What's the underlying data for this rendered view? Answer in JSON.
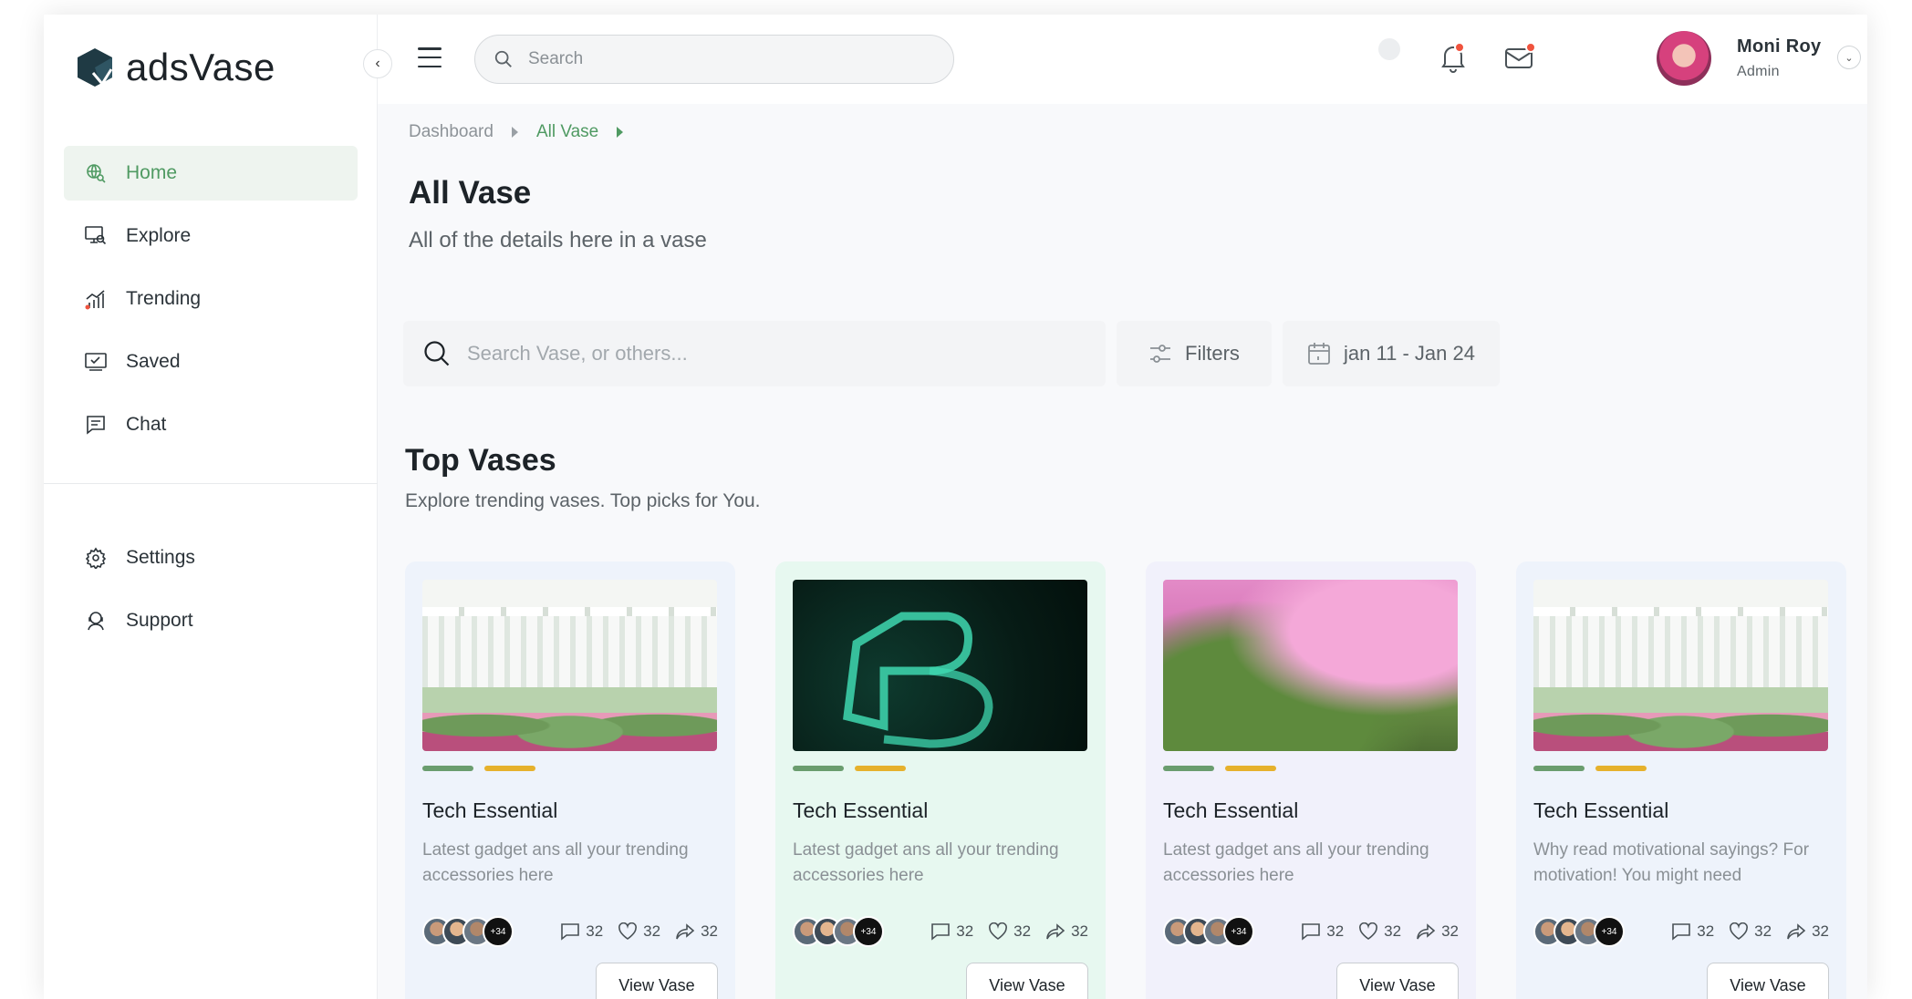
{
  "app": {
    "name": "adsVase"
  },
  "sidebar": {
    "items": [
      {
        "label": "Home",
        "icon": "globe-search-icon",
        "active": true
      },
      {
        "label": "Explore",
        "icon": "monitor-search-icon"
      },
      {
        "label": "Trending",
        "icon": "chart-bars-icon"
      },
      {
        "label": "Saved",
        "icon": "saved-monitor-icon"
      },
      {
        "label": "Chat",
        "icon": "chat-icon"
      }
    ],
    "secondary": [
      {
        "label": "Settings",
        "icon": "gear-icon"
      },
      {
        "label": "Support",
        "icon": "headset-icon"
      }
    ]
  },
  "topbar": {
    "search_placeholder": "Search",
    "user": {
      "name": "Moni Roy",
      "role": "Admin"
    }
  },
  "breadcrumb": {
    "root": "Dashboard",
    "current": "All Vase"
  },
  "page": {
    "title": "All Vase",
    "subtitle": "All of the details here in  a vase"
  },
  "filters": {
    "search_placeholder": "Search Vase, or others...",
    "filters_label": "Filters",
    "date_range": "jan 11 - Jan 24"
  },
  "section": {
    "title": "Top Vases",
    "subtitle": "Explore trending vases.  Top picks for You."
  },
  "cards": [
    {
      "title": "Tech Essential",
      "desc": "Latest gadget ans all your trending accessories here",
      "more": "+34",
      "comments": "32",
      "likes": "32",
      "shares": "32",
      "button": "View Vase",
      "image": "greenhouse"
    },
    {
      "title": "Tech Essential",
      "desc": "Latest gadget ans all your trending accessories here",
      "more": "+34",
      "comments": "32",
      "likes": "32",
      "shares": "32",
      "button": "View Vase",
      "image": "neon-sign"
    },
    {
      "title": "Tech Essential",
      "desc": "Latest gadget ans all your trending accessories here",
      "more": "+34",
      "comments": "32",
      "likes": "32",
      "shares": "32",
      "button": "View Vase",
      "image": "plants"
    },
    {
      "title": "Tech Essential",
      "desc": "Why read motivational sayings? For motivation! You might need",
      "more": "+34",
      "comments": "32",
      "likes": "32",
      "shares": "32",
      "button": "View Vase",
      "image": "greenhouse"
    }
  ],
  "colors": {
    "accent": "#4f9a62",
    "active_bg": "#eef4ef",
    "progress_green": "#6a9d6e",
    "progress_yellow": "#e6b12c",
    "notification": "#f0533e"
  }
}
